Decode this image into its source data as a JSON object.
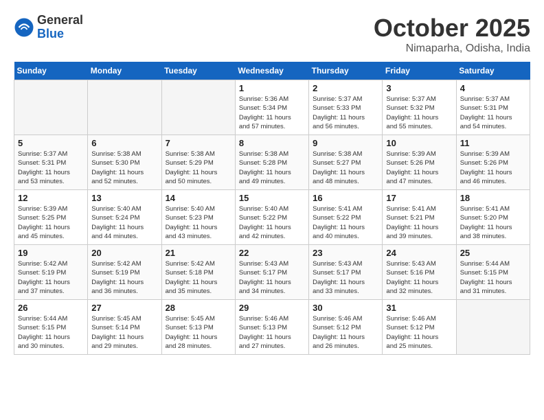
{
  "header": {
    "logo_general": "General",
    "logo_blue": "Blue",
    "month": "October 2025",
    "location": "Nimaparha, Odisha, India"
  },
  "days_of_week": [
    "Sunday",
    "Monday",
    "Tuesday",
    "Wednesday",
    "Thursday",
    "Friday",
    "Saturday"
  ],
  "weeks": [
    [
      {
        "day": "",
        "info": ""
      },
      {
        "day": "",
        "info": ""
      },
      {
        "day": "",
        "info": ""
      },
      {
        "day": "1",
        "info": "Sunrise: 5:36 AM\nSunset: 5:34 PM\nDaylight: 11 hours\nand 57 minutes."
      },
      {
        "day": "2",
        "info": "Sunrise: 5:37 AM\nSunset: 5:33 PM\nDaylight: 11 hours\nand 56 minutes."
      },
      {
        "day": "3",
        "info": "Sunrise: 5:37 AM\nSunset: 5:32 PM\nDaylight: 11 hours\nand 55 minutes."
      },
      {
        "day": "4",
        "info": "Sunrise: 5:37 AM\nSunset: 5:31 PM\nDaylight: 11 hours\nand 54 minutes."
      }
    ],
    [
      {
        "day": "5",
        "info": "Sunrise: 5:37 AM\nSunset: 5:31 PM\nDaylight: 11 hours\nand 53 minutes."
      },
      {
        "day": "6",
        "info": "Sunrise: 5:38 AM\nSunset: 5:30 PM\nDaylight: 11 hours\nand 52 minutes."
      },
      {
        "day": "7",
        "info": "Sunrise: 5:38 AM\nSunset: 5:29 PM\nDaylight: 11 hours\nand 50 minutes."
      },
      {
        "day": "8",
        "info": "Sunrise: 5:38 AM\nSunset: 5:28 PM\nDaylight: 11 hours\nand 49 minutes."
      },
      {
        "day": "9",
        "info": "Sunrise: 5:38 AM\nSunset: 5:27 PM\nDaylight: 11 hours\nand 48 minutes."
      },
      {
        "day": "10",
        "info": "Sunrise: 5:39 AM\nSunset: 5:26 PM\nDaylight: 11 hours\nand 47 minutes."
      },
      {
        "day": "11",
        "info": "Sunrise: 5:39 AM\nSunset: 5:26 PM\nDaylight: 11 hours\nand 46 minutes."
      }
    ],
    [
      {
        "day": "12",
        "info": "Sunrise: 5:39 AM\nSunset: 5:25 PM\nDaylight: 11 hours\nand 45 minutes."
      },
      {
        "day": "13",
        "info": "Sunrise: 5:40 AM\nSunset: 5:24 PM\nDaylight: 11 hours\nand 44 minutes."
      },
      {
        "day": "14",
        "info": "Sunrise: 5:40 AM\nSunset: 5:23 PM\nDaylight: 11 hours\nand 43 minutes."
      },
      {
        "day": "15",
        "info": "Sunrise: 5:40 AM\nSunset: 5:22 PM\nDaylight: 11 hours\nand 42 minutes."
      },
      {
        "day": "16",
        "info": "Sunrise: 5:41 AM\nSunset: 5:22 PM\nDaylight: 11 hours\nand 40 minutes."
      },
      {
        "day": "17",
        "info": "Sunrise: 5:41 AM\nSunset: 5:21 PM\nDaylight: 11 hours\nand 39 minutes."
      },
      {
        "day": "18",
        "info": "Sunrise: 5:41 AM\nSunset: 5:20 PM\nDaylight: 11 hours\nand 38 minutes."
      }
    ],
    [
      {
        "day": "19",
        "info": "Sunrise: 5:42 AM\nSunset: 5:19 PM\nDaylight: 11 hours\nand 37 minutes."
      },
      {
        "day": "20",
        "info": "Sunrise: 5:42 AM\nSunset: 5:19 PM\nDaylight: 11 hours\nand 36 minutes."
      },
      {
        "day": "21",
        "info": "Sunrise: 5:42 AM\nSunset: 5:18 PM\nDaylight: 11 hours\nand 35 minutes."
      },
      {
        "day": "22",
        "info": "Sunrise: 5:43 AM\nSunset: 5:17 PM\nDaylight: 11 hours\nand 34 minutes."
      },
      {
        "day": "23",
        "info": "Sunrise: 5:43 AM\nSunset: 5:17 PM\nDaylight: 11 hours\nand 33 minutes."
      },
      {
        "day": "24",
        "info": "Sunrise: 5:43 AM\nSunset: 5:16 PM\nDaylight: 11 hours\nand 32 minutes."
      },
      {
        "day": "25",
        "info": "Sunrise: 5:44 AM\nSunset: 5:15 PM\nDaylight: 11 hours\nand 31 minutes."
      }
    ],
    [
      {
        "day": "26",
        "info": "Sunrise: 5:44 AM\nSunset: 5:15 PM\nDaylight: 11 hours\nand 30 minutes."
      },
      {
        "day": "27",
        "info": "Sunrise: 5:45 AM\nSunset: 5:14 PM\nDaylight: 11 hours\nand 29 minutes."
      },
      {
        "day": "28",
        "info": "Sunrise: 5:45 AM\nSunset: 5:13 PM\nDaylight: 11 hours\nand 28 minutes."
      },
      {
        "day": "29",
        "info": "Sunrise: 5:46 AM\nSunset: 5:13 PM\nDaylight: 11 hours\nand 27 minutes."
      },
      {
        "day": "30",
        "info": "Sunrise: 5:46 AM\nSunset: 5:12 PM\nDaylight: 11 hours\nand 26 minutes."
      },
      {
        "day": "31",
        "info": "Sunrise: 5:46 AM\nSunset: 5:12 PM\nDaylight: 11 hours\nand 25 minutes."
      },
      {
        "day": "",
        "info": ""
      }
    ]
  ]
}
